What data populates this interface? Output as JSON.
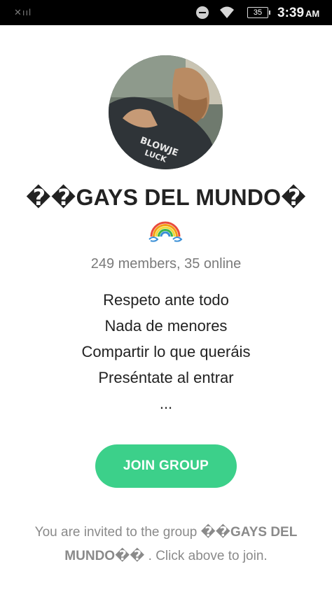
{
  "status_bar": {
    "signal": "✕ııl",
    "battery_level": "35",
    "time": "3:39",
    "ampm": "AM",
    "icons": [
      "signal-icon",
      "do-not-disturb-icon",
      "wifi-icon",
      "battery-icon"
    ]
  },
  "group": {
    "avatar_icon": "group-avatar-image",
    "title": "��GAYS DEL MUNDO�",
    "title_emoji": "rainbow-icon",
    "members_text": "249 members, 35 online",
    "description_lines": [
      "Respeto ante todo",
      "Nada de menores",
      "Compartir lo que queráis",
      "Preséntate al entrar",
      "..."
    ]
  },
  "actions": {
    "join_label": "JOIN GROUP",
    "accent_color": "#3cd08a"
  },
  "footer": {
    "invite_prefix": "You are invited to the group ",
    "invite_group_name": "��GAYS DEL MUNDO��",
    "invite_suffix": " . Click above to join."
  }
}
